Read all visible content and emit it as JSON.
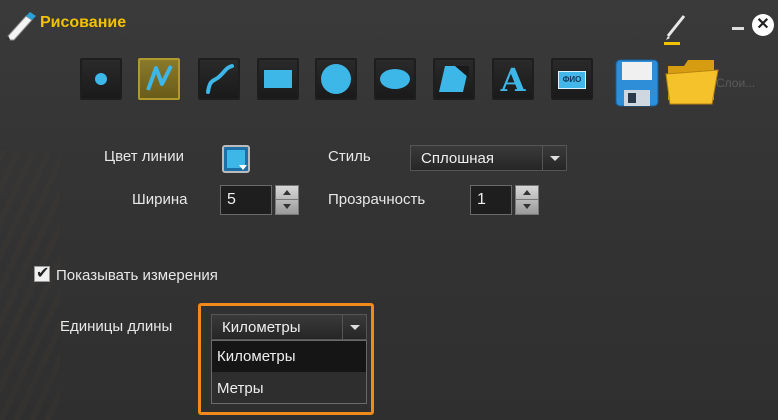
{
  "window": {
    "title": "Рисование",
    "background_title": "",
    "accent_color": "#f2c200"
  },
  "header": {
    "minimize_icon": "minimize-icon",
    "close_icon": "close-icon",
    "pen_icon": "pen-icon",
    "close_glyph": "✕"
  },
  "toolbar": {
    "tools": [
      {
        "name": "point",
        "icon": "point-icon"
      },
      {
        "name": "polyline",
        "icon": "polyline-icon",
        "active": true
      },
      {
        "name": "curve",
        "icon": "curve-icon"
      },
      {
        "name": "rectangle",
        "icon": "rectangle-icon"
      },
      {
        "name": "circle",
        "icon": "circle-icon"
      },
      {
        "name": "ellipse",
        "icon": "ellipse-icon"
      },
      {
        "name": "polygon",
        "icon": "polygon-icon"
      },
      {
        "name": "text",
        "icon": "text-icon",
        "glyph": "A"
      },
      {
        "name": "fio",
        "icon": "fio-icon",
        "label": "ФИО"
      },
      {
        "name": "save",
        "icon": "save-icon"
      },
      {
        "name": "open",
        "icon": "folder-icon"
      }
    ],
    "ghost_text": "Слои..."
  },
  "line_color": {
    "label": "Цвет линии",
    "color": "#3db6e8"
  },
  "style": {
    "label": "Стиль",
    "value": "Сплошная"
  },
  "width": {
    "label": "Ширина",
    "value": "5"
  },
  "opacity": {
    "label": "Прозрачность",
    "value": "1"
  },
  "show_measurements": {
    "label": "Показывать измерения",
    "checked": true
  },
  "length_units": {
    "label": "Единицы длины",
    "value": "Километры",
    "options": [
      "Километры",
      "Метры"
    ],
    "highlight_color": "#f08a1a"
  }
}
